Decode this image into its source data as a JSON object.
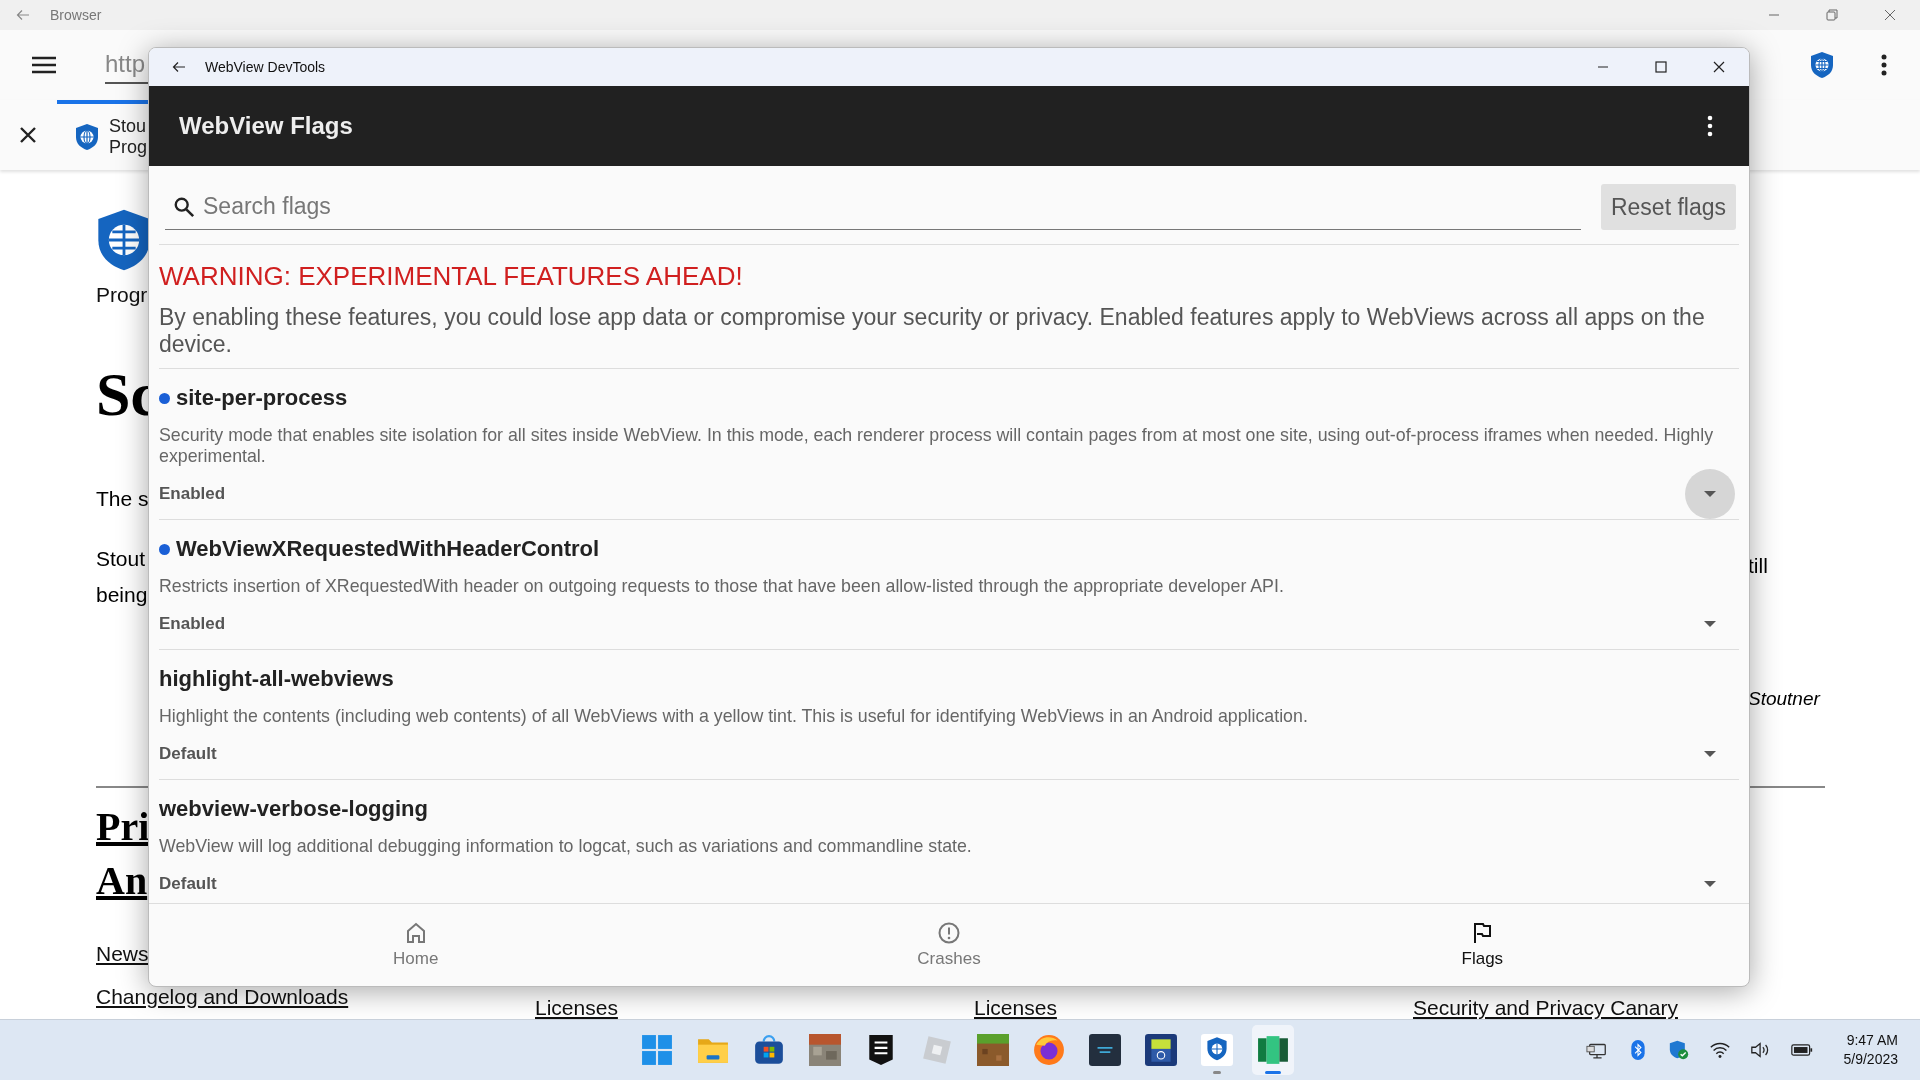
{
  "browser": {
    "title": "Browser",
    "url": "http",
    "tab": {
      "line_1": "Stou",
      "line_2": "Prog",
      "selected": true
    }
  },
  "page": {
    "logo_caption": "Progr",
    "heading": "Sc",
    "paragraph_1": "The s",
    "paragraph_2_left": [
      "Stout",
      "being"
    ],
    "paragraph_2_right": "till",
    "byline": "Stoutner",
    "section_heading": [
      "Pri",
      "An"
    ],
    "footer_columns": [
      [
        "News",
        "Changelog and Downloads"
      ],
      [
        "Licenses"
      ],
      [
        "Licenses"
      ],
      [
        "Security and Privacy Canary"
      ]
    ]
  },
  "devtools": {
    "window_title": "WebView DevTools",
    "app_title": "WebView Flags",
    "search": {
      "placeholder": "Search flags"
    },
    "reset_button": "Reset flags",
    "warning_title": "WARNING: EXPERIMENTAL FEATURES AHEAD!",
    "warning_text": "By enabling these features, you could lose app data or compromise your security or privacy. Enabled features apply to WebViews across all apps on the device.",
    "flags": [
      {
        "name": "site-per-process",
        "modified": true,
        "description": "Security mode that enables site isolation for all sites inside WebView. In this mode, each renderer process will contain pages from at most one site, using out-of-process iframes when needed. Highly experimental.",
        "state": "Enabled",
        "focused": true
      },
      {
        "name": "WebViewXRequestedWithHeaderControl",
        "modified": true,
        "description": "Restricts insertion of XRequestedWith header on outgoing requests to those that have been allow-listed through the appropriate developer API.",
        "state": "Enabled",
        "focused": false
      },
      {
        "name": "highlight-all-webviews",
        "modified": false,
        "description": "Highlight the contents (including web contents) of all WebViews with a yellow tint. This is useful for identifying WebViews in an Android application.",
        "state": "Default",
        "focused": false
      },
      {
        "name": "webview-verbose-logging",
        "modified": false,
        "description": "WebView will log additional debugging information to logcat, such as variations and commandline state.",
        "state": "Default",
        "focused": false
      }
    ],
    "nav": [
      {
        "kind": "home",
        "label": "Home",
        "selected": false
      },
      {
        "kind": "crashes",
        "label": "Crashes",
        "selected": false
      },
      {
        "kind": "flags",
        "label": "Flags",
        "selected": true
      }
    ]
  },
  "taskbar": {
    "apps": [
      {
        "kind": "start",
        "running": false,
        "selected": false
      },
      {
        "kind": "folder",
        "running": false,
        "selected": false
      },
      {
        "kind": "store",
        "running": false,
        "selected": false
      },
      {
        "kind": "blocks",
        "running": false,
        "selected": false
      },
      {
        "kind": "epic",
        "running": false,
        "selected": false
      },
      {
        "kind": "cube",
        "running": false,
        "selected": false
      },
      {
        "kind": "grass",
        "running": false,
        "selected": false
      },
      {
        "kind": "firefox",
        "running": false,
        "selected": false
      },
      {
        "kind": "dark",
        "running": false,
        "selected": false
      },
      {
        "kind": "android",
        "running": false,
        "selected": false
      },
      {
        "kind": "shield",
        "running": true,
        "selected": false
      },
      {
        "kind": "green",
        "running": true,
        "selected": true
      }
    ],
    "time": "9:47 AM",
    "date": "5/9/2023"
  }
}
